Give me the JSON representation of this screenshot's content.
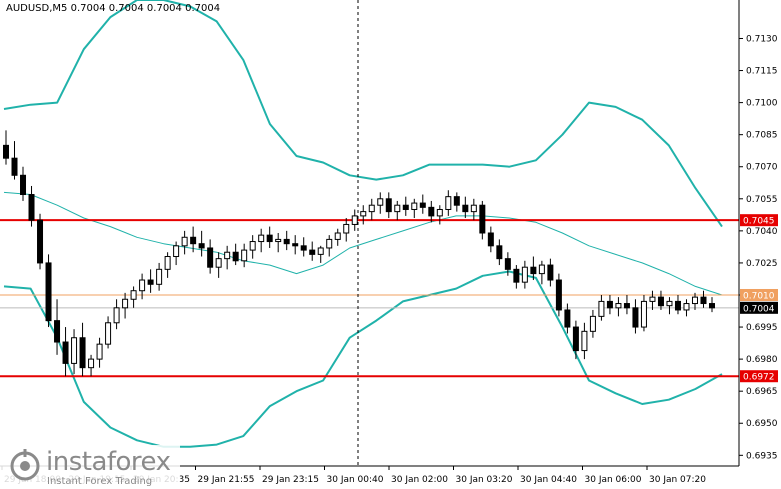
{
  "header": {
    "symbol_info": "AUDUSD,M5  0.7004 0.7004 0.7004 0.7004"
  },
  "branding": {
    "name": "instaforex",
    "tagline": "Instant Forex Trading"
  },
  "chart_data": {
    "type": "candlestick",
    "title": "AUDUSD,M5",
    "ylim": [
      0.693,
      0.7148
    ],
    "y_ticks": [
      "0.7130",
      "0.7115",
      "0.7100",
      "0.7085",
      "0.7070",
      "0.7055",
      "0.7040",
      "0.7025",
      "0.7010",
      "0.6995",
      "0.6980",
      "0.6965",
      "0.6950",
      "0.6935"
    ],
    "x_tick_labels": [
      "29 Jan 18:00",
      "29 Jan 19:15",
      "29 Jan 20:35",
      "29 Jan 21:55",
      "29 Jan 23:15",
      "30 Jan 00:40",
      "30 Jan 02:00",
      "30 Jan 03:20",
      "30 Jan 04:40",
      "30 Jan 06:00",
      "30 Jan 07:20"
    ],
    "price_tags": [
      {
        "label": "0.7045",
        "value": 0.7045,
        "color": "#e60000"
      },
      {
        "label": "0.7010",
        "value": 0.701,
        "color": "#f0a060"
      },
      {
        "label": "0.7004",
        "value": 0.7004,
        "color": "#000000"
      },
      {
        "label": "0.6972",
        "value": 0.6972,
        "color": "#e60000"
      }
    ],
    "levels": [
      {
        "name": "resistance",
        "value": 0.7045,
        "color": "#e60000"
      },
      {
        "name": "support",
        "value": 0.6972,
        "color": "#e60000"
      },
      {
        "name": "ask",
        "value": 0.701,
        "color": "#f0a060"
      },
      {
        "name": "bid",
        "value": 0.7004,
        "color": "#bbbbbb"
      }
    ],
    "bollinger": {
      "color": "#20b2aa",
      "upper": [
        0.7097,
        0.7099,
        0.71,
        0.7125,
        0.714,
        0.7148,
        0.7148,
        0.7145,
        0.7138,
        0.712,
        0.709,
        0.7075,
        0.7072,
        0.7066,
        0.7064,
        0.7066,
        0.7071,
        0.7071,
        0.7071,
        0.707,
        0.7073,
        0.7085,
        0.71,
        0.7098,
        0.7092,
        0.708,
        0.706,
        0.7042
      ],
      "middle": [
        0.7058,
        0.7057,
        0.7052,
        0.7046,
        0.7042,
        0.7037,
        0.7034,
        0.7032,
        0.703,
        0.7026,
        0.7024,
        0.702,
        0.7024,
        0.7032,
        0.7036,
        0.704,
        0.7044,
        0.7047,
        0.7047,
        0.7046,
        0.7044,
        0.7039,
        0.7033,
        0.7029,
        0.7025,
        0.702,
        0.7014,
        0.701
      ],
      "lower": [
        0.7014,
        0.7013,
        0.699,
        0.696,
        0.6948,
        0.6942,
        0.6939,
        0.6939,
        0.694,
        0.6944,
        0.6958,
        0.6965,
        0.697,
        0.699,
        0.6998,
        0.7007,
        0.701,
        0.7013,
        0.7019,
        0.7021,
        0.7018,
        0.6995,
        0.697,
        0.6964,
        0.6959,
        0.6961,
        0.6966,
        0.6973
      ]
    },
    "candles": [
      {
        "o": 0.708,
        "h": 0.7087,
        "l": 0.7071,
        "c": 0.7074
      },
      {
        "o": 0.7074,
        "h": 0.7082,
        "l": 0.7064,
        "c": 0.7066
      },
      {
        "o": 0.7066,
        "h": 0.707,
        "l": 0.7054,
        "c": 0.7057
      },
      {
        "o": 0.7057,
        "h": 0.7061,
        "l": 0.7042,
        "c": 0.7045
      },
      {
        "o": 0.7045,
        "h": 0.7048,
        "l": 0.7022,
        "c": 0.7025
      },
      {
        "o": 0.7025,
        "h": 0.7029,
        "l": 0.6995,
        "c": 0.6998
      },
      {
        "o": 0.6998,
        "h": 0.7008,
        "l": 0.6982,
        "c": 0.6988
      },
      {
        "o": 0.6988,
        "h": 0.6995,
        "l": 0.6972,
        "c": 0.6978
      },
      {
        "o": 0.6978,
        "h": 0.6994,
        "l": 0.6973,
        "c": 0.699
      },
      {
        "o": 0.699,
        "h": 0.6997,
        "l": 0.6972,
        "c": 0.6976
      },
      {
        "o": 0.6976,
        "h": 0.6982,
        "l": 0.6972,
        "c": 0.698
      },
      {
        "o": 0.698,
        "h": 0.699,
        "l": 0.6976,
        "c": 0.6987
      },
      {
        "o": 0.6987,
        "h": 0.7,
        "l": 0.6985,
        "c": 0.6997
      },
      {
        "o": 0.6997,
        "h": 0.7008,
        "l": 0.6994,
        "c": 0.7004
      },
      {
        "o": 0.7004,
        "h": 0.7011,
        "l": 0.6999,
        "c": 0.7008
      },
      {
        "o": 0.7008,
        "h": 0.7014,
        "l": 0.7004,
        "c": 0.7012
      },
      {
        "o": 0.7012,
        "h": 0.702,
        "l": 0.7008,
        "c": 0.7017
      },
      {
        "o": 0.7017,
        "h": 0.7022,
        "l": 0.7011,
        "c": 0.7015
      },
      {
        "o": 0.7015,
        "h": 0.7025,
        "l": 0.7012,
        "c": 0.7022
      },
      {
        "o": 0.7022,
        "h": 0.703,
        "l": 0.7018,
        "c": 0.7028
      },
      {
        "o": 0.7028,
        "h": 0.7035,
        "l": 0.7024,
        "c": 0.7033
      },
      {
        "o": 0.7033,
        "h": 0.704,
        "l": 0.7029,
        "c": 0.7037
      },
      {
        "o": 0.7037,
        "h": 0.7042,
        "l": 0.703,
        "c": 0.7034
      },
      {
        "o": 0.7034,
        "h": 0.704,
        "l": 0.7028,
        "c": 0.7032
      },
      {
        "o": 0.7032,
        "h": 0.7036,
        "l": 0.702,
        "c": 0.7023
      },
      {
        "o": 0.7023,
        "h": 0.703,
        "l": 0.7018,
        "c": 0.7027
      },
      {
        "o": 0.7027,
        "h": 0.7033,
        "l": 0.7022,
        "c": 0.703
      },
      {
        "o": 0.703,
        "h": 0.7034,
        "l": 0.7024,
        "c": 0.7026
      },
      {
        "o": 0.7026,
        "h": 0.7034,
        "l": 0.7023,
        "c": 0.7031
      },
      {
        "o": 0.7031,
        "h": 0.7038,
        "l": 0.7027,
        "c": 0.7035
      },
      {
        "o": 0.7035,
        "h": 0.7041,
        "l": 0.703,
        "c": 0.7038
      },
      {
        "o": 0.7038,
        "h": 0.7042,
        "l": 0.7032,
        "c": 0.7035
      },
      {
        "o": 0.7035,
        "h": 0.7039,
        "l": 0.703,
        "c": 0.7036
      },
      {
        "o": 0.7036,
        "h": 0.704,
        "l": 0.7031,
        "c": 0.7034
      },
      {
        "o": 0.7034,
        "h": 0.7038,
        "l": 0.7029,
        "c": 0.7033
      },
      {
        "o": 0.7033,
        "h": 0.7037,
        "l": 0.7028,
        "c": 0.7031
      },
      {
        "o": 0.7031,
        "h": 0.7035,
        "l": 0.7026,
        "c": 0.7029
      },
      {
        "o": 0.7029,
        "h": 0.7033,
        "l": 0.7025,
        "c": 0.7032
      },
      {
        "o": 0.7032,
        "h": 0.7038,
        "l": 0.7028,
        "c": 0.7036
      },
      {
        "o": 0.7036,
        "h": 0.7041,
        "l": 0.7033,
        "c": 0.7039
      },
      {
        "o": 0.7039,
        "h": 0.7046,
        "l": 0.7035,
        "c": 0.7043
      },
      {
        "o": 0.7043,
        "h": 0.705,
        "l": 0.704,
        "c": 0.7047
      },
      {
        "o": 0.7047,
        "h": 0.7052,
        "l": 0.7043,
        "c": 0.7049
      },
      {
        "o": 0.7049,
        "h": 0.7055,
        "l": 0.7045,
        "c": 0.7052
      },
      {
        "o": 0.7052,
        "h": 0.7058,
        "l": 0.7048,
        "c": 0.7055
      },
      {
        "o": 0.7055,
        "h": 0.7058,
        "l": 0.7046,
        "c": 0.7049
      },
      {
        "o": 0.7049,
        "h": 0.7054,
        "l": 0.7045,
        "c": 0.7052
      },
      {
        "o": 0.7052,
        "h": 0.7056,
        "l": 0.7047,
        "c": 0.705
      },
      {
        "o": 0.705,
        "h": 0.7055,
        "l": 0.7046,
        "c": 0.7053
      },
      {
        "o": 0.7053,
        "h": 0.7057,
        "l": 0.7048,
        "c": 0.7051
      },
      {
        "o": 0.7051,
        "h": 0.7054,
        "l": 0.7044,
        "c": 0.7047
      },
      {
        "o": 0.7047,
        "h": 0.7052,
        "l": 0.7043,
        "c": 0.705
      },
      {
        "o": 0.705,
        "h": 0.7059,
        "l": 0.7047,
        "c": 0.7056
      },
      {
        "o": 0.7056,
        "h": 0.7058,
        "l": 0.7049,
        "c": 0.7052
      },
      {
        "o": 0.7052,
        "h": 0.7056,
        "l": 0.7046,
        "c": 0.7049
      },
      {
        "o": 0.7049,
        "h": 0.7055,
        "l": 0.7045,
        "c": 0.7052
      },
      {
        "o": 0.7052,
        "h": 0.7054,
        "l": 0.7036,
        "c": 0.7039
      },
      {
        "o": 0.7039,
        "h": 0.7042,
        "l": 0.703,
        "c": 0.7033
      },
      {
        "o": 0.7033,
        "h": 0.7036,
        "l": 0.7024,
        "c": 0.7027
      },
      {
        "o": 0.7027,
        "h": 0.703,
        "l": 0.7019,
        "c": 0.7022
      },
      {
        "o": 0.7022,
        "h": 0.7024,
        "l": 0.7013,
        "c": 0.7016
      },
      {
        "o": 0.7016,
        "h": 0.7026,
        "l": 0.7013,
        "c": 0.7023
      },
      {
        "o": 0.7023,
        "h": 0.7028,
        "l": 0.7017,
        "c": 0.702
      },
      {
        "o": 0.702,
        "h": 0.7026,
        "l": 0.7015,
        "c": 0.7024
      },
      {
        "o": 0.7024,
        "h": 0.7027,
        "l": 0.7014,
        "c": 0.7017
      },
      {
        "o": 0.7017,
        "h": 0.702,
        "l": 0.7,
        "c": 0.7003
      },
      {
        "o": 0.7003,
        "h": 0.7006,
        "l": 0.6992,
        "c": 0.6995
      },
      {
        "o": 0.6995,
        "h": 0.6998,
        "l": 0.698,
        "c": 0.6984
      },
      {
        "o": 0.6984,
        "h": 0.6997,
        "l": 0.698,
        "c": 0.6993
      },
      {
        "o": 0.6993,
        "h": 0.7003,
        "l": 0.699,
        "c": 0.7
      },
      {
        "o": 0.7,
        "h": 0.701,
        "l": 0.6998,
        "c": 0.7007
      },
      {
        "o": 0.7007,
        "h": 0.701,
        "l": 0.7001,
        "c": 0.7004
      },
      {
        "o": 0.7004,
        "h": 0.7009,
        "l": 0.7,
        "c": 0.7006
      },
      {
        "o": 0.7006,
        "h": 0.701,
        "l": 0.7001,
        "c": 0.7004
      },
      {
        "o": 0.7004,
        "h": 0.7008,
        "l": 0.6992,
        "c": 0.6995
      },
      {
        "o": 0.6995,
        "h": 0.701,
        "l": 0.6993,
        "c": 0.7007
      },
      {
        "o": 0.7007,
        "h": 0.7012,
        "l": 0.7003,
        "c": 0.7009
      },
      {
        "o": 0.7009,
        "h": 0.7012,
        "l": 0.7003,
        "c": 0.7005
      },
      {
        "o": 0.7005,
        "h": 0.7009,
        "l": 0.7001,
        "c": 0.7007
      },
      {
        "o": 0.7007,
        "h": 0.701,
        "l": 0.7001,
        "c": 0.7003
      },
      {
        "o": 0.7003,
        "h": 0.7008,
        "l": 0.7,
        "c": 0.7006
      },
      {
        "o": 0.7006,
        "h": 0.7011,
        "l": 0.7003,
        "c": 0.7009
      },
      {
        "o": 0.7009,
        "h": 0.7012,
        "l": 0.7004,
        "c": 0.7006
      },
      {
        "o": 0.7006,
        "h": 0.7009,
        "l": 0.7002,
        "c": 0.7004
      }
    ]
  }
}
